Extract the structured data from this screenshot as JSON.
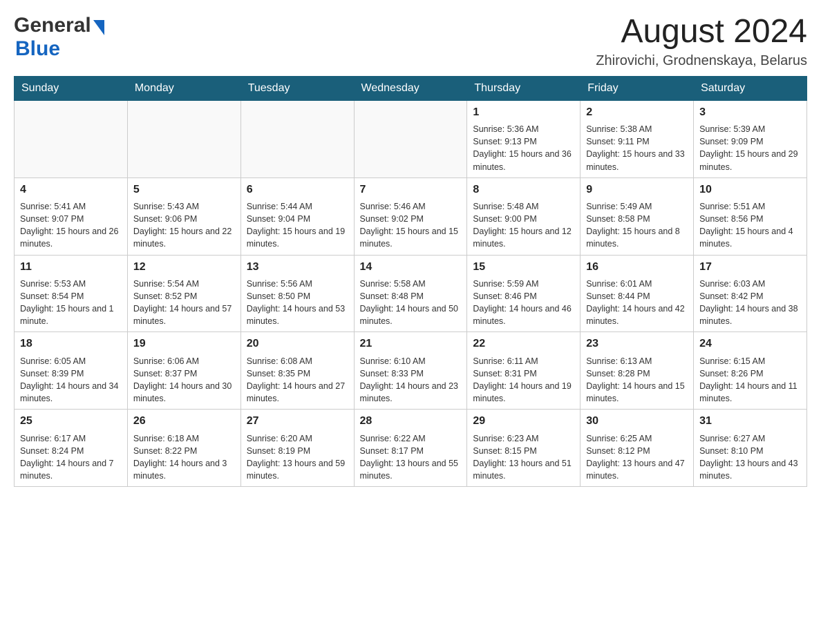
{
  "header": {
    "logo": {
      "general": "General",
      "blue": "Blue"
    },
    "title": "August 2024",
    "location": "Zhirovichi, Grodnenskaya, Belarus"
  },
  "calendar": {
    "days_of_week": [
      "Sunday",
      "Monday",
      "Tuesday",
      "Wednesday",
      "Thursday",
      "Friday",
      "Saturday"
    ],
    "weeks": [
      [
        {
          "day": "",
          "info": ""
        },
        {
          "day": "",
          "info": ""
        },
        {
          "day": "",
          "info": ""
        },
        {
          "day": "",
          "info": ""
        },
        {
          "day": "1",
          "info": "Sunrise: 5:36 AM\nSunset: 9:13 PM\nDaylight: 15 hours and 36 minutes."
        },
        {
          "day": "2",
          "info": "Sunrise: 5:38 AM\nSunset: 9:11 PM\nDaylight: 15 hours and 33 minutes."
        },
        {
          "day": "3",
          "info": "Sunrise: 5:39 AM\nSunset: 9:09 PM\nDaylight: 15 hours and 29 minutes."
        }
      ],
      [
        {
          "day": "4",
          "info": "Sunrise: 5:41 AM\nSunset: 9:07 PM\nDaylight: 15 hours and 26 minutes."
        },
        {
          "day": "5",
          "info": "Sunrise: 5:43 AM\nSunset: 9:06 PM\nDaylight: 15 hours and 22 minutes."
        },
        {
          "day": "6",
          "info": "Sunrise: 5:44 AM\nSunset: 9:04 PM\nDaylight: 15 hours and 19 minutes."
        },
        {
          "day": "7",
          "info": "Sunrise: 5:46 AM\nSunset: 9:02 PM\nDaylight: 15 hours and 15 minutes."
        },
        {
          "day": "8",
          "info": "Sunrise: 5:48 AM\nSunset: 9:00 PM\nDaylight: 15 hours and 12 minutes."
        },
        {
          "day": "9",
          "info": "Sunrise: 5:49 AM\nSunset: 8:58 PM\nDaylight: 15 hours and 8 minutes."
        },
        {
          "day": "10",
          "info": "Sunrise: 5:51 AM\nSunset: 8:56 PM\nDaylight: 15 hours and 4 minutes."
        }
      ],
      [
        {
          "day": "11",
          "info": "Sunrise: 5:53 AM\nSunset: 8:54 PM\nDaylight: 15 hours and 1 minute."
        },
        {
          "day": "12",
          "info": "Sunrise: 5:54 AM\nSunset: 8:52 PM\nDaylight: 14 hours and 57 minutes."
        },
        {
          "day": "13",
          "info": "Sunrise: 5:56 AM\nSunset: 8:50 PM\nDaylight: 14 hours and 53 minutes."
        },
        {
          "day": "14",
          "info": "Sunrise: 5:58 AM\nSunset: 8:48 PM\nDaylight: 14 hours and 50 minutes."
        },
        {
          "day": "15",
          "info": "Sunrise: 5:59 AM\nSunset: 8:46 PM\nDaylight: 14 hours and 46 minutes."
        },
        {
          "day": "16",
          "info": "Sunrise: 6:01 AM\nSunset: 8:44 PM\nDaylight: 14 hours and 42 minutes."
        },
        {
          "day": "17",
          "info": "Sunrise: 6:03 AM\nSunset: 8:42 PM\nDaylight: 14 hours and 38 minutes."
        }
      ],
      [
        {
          "day": "18",
          "info": "Sunrise: 6:05 AM\nSunset: 8:39 PM\nDaylight: 14 hours and 34 minutes."
        },
        {
          "day": "19",
          "info": "Sunrise: 6:06 AM\nSunset: 8:37 PM\nDaylight: 14 hours and 30 minutes."
        },
        {
          "day": "20",
          "info": "Sunrise: 6:08 AM\nSunset: 8:35 PM\nDaylight: 14 hours and 27 minutes."
        },
        {
          "day": "21",
          "info": "Sunrise: 6:10 AM\nSunset: 8:33 PM\nDaylight: 14 hours and 23 minutes."
        },
        {
          "day": "22",
          "info": "Sunrise: 6:11 AM\nSunset: 8:31 PM\nDaylight: 14 hours and 19 minutes."
        },
        {
          "day": "23",
          "info": "Sunrise: 6:13 AM\nSunset: 8:28 PM\nDaylight: 14 hours and 15 minutes."
        },
        {
          "day": "24",
          "info": "Sunrise: 6:15 AM\nSunset: 8:26 PM\nDaylight: 14 hours and 11 minutes."
        }
      ],
      [
        {
          "day": "25",
          "info": "Sunrise: 6:17 AM\nSunset: 8:24 PM\nDaylight: 14 hours and 7 minutes."
        },
        {
          "day": "26",
          "info": "Sunrise: 6:18 AM\nSunset: 8:22 PM\nDaylight: 14 hours and 3 minutes."
        },
        {
          "day": "27",
          "info": "Sunrise: 6:20 AM\nSunset: 8:19 PM\nDaylight: 13 hours and 59 minutes."
        },
        {
          "day": "28",
          "info": "Sunrise: 6:22 AM\nSunset: 8:17 PM\nDaylight: 13 hours and 55 minutes."
        },
        {
          "day": "29",
          "info": "Sunrise: 6:23 AM\nSunset: 8:15 PM\nDaylight: 13 hours and 51 minutes."
        },
        {
          "day": "30",
          "info": "Sunrise: 6:25 AM\nSunset: 8:12 PM\nDaylight: 13 hours and 47 minutes."
        },
        {
          "day": "31",
          "info": "Sunrise: 6:27 AM\nSunset: 8:10 PM\nDaylight: 13 hours and 43 minutes."
        }
      ]
    ]
  }
}
